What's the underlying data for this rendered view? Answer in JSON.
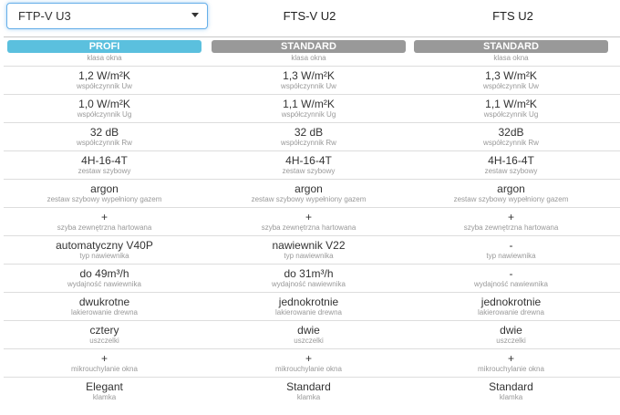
{
  "selector": {
    "value": "FTP-V U3"
  },
  "columns": [
    "FTS-V U2",
    "FTS U2"
  ],
  "badge_colors": {
    "profi": "#5bc0de",
    "standard": "#999999"
  },
  "rows": [
    {
      "label": "klasa okna",
      "values": [
        "PROFI",
        "STANDARD",
        "STANDARD"
      ]
    },
    {
      "label": "współczynnik Uw",
      "values": [
        "1,2 W/m²K",
        "1,3 W/m²K",
        "1,3 W/m²K"
      ]
    },
    {
      "label": "współczynnik Ug",
      "values": [
        "1,0 W/m²K",
        "1,1 W/m²K",
        "1,1 W/m²K"
      ]
    },
    {
      "label": "współczynnik Rw",
      "values": [
        "32 dB",
        "32 dB",
        "32dB"
      ]
    },
    {
      "label": "zestaw szybowy",
      "values": [
        "4H-16-4T",
        "4H-16-4T",
        "4H-16-4T"
      ]
    },
    {
      "label": "zestaw szybowy wypełniony gazem",
      "values": [
        "argon",
        "argon",
        "argon"
      ]
    },
    {
      "label": "szyba zewnętrzna hartowana",
      "values": [
        "+",
        "+",
        "+"
      ]
    },
    {
      "label": "typ nawiewnika",
      "values": [
        "automatyczny V40P",
        "nawiewnik V22",
        "-"
      ]
    },
    {
      "label": "wydajność nawiewnika",
      "values": [
        "do 49m³/h",
        "do 31m³/h",
        "-"
      ]
    },
    {
      "label": "lakierowanie drewna",
      "values": [
        "dwukrotne",
        "jednokrotnie",
        "jednokrotnie"
      ]
    },
    {
      "label": "uszczelki",
      "values": [
        "cztery",
        "dwie",
        "dwie"
      ]
    },
    {
      "label": "mikrouchylanie okna",
      "values": [
        "+",
        "+",
        "+"
      ]
    },
    {
      "label": "klamka",
      "values": [
        "Elegant",
        "Standard",
        "Standard"
      ]
    }
  ]
}
